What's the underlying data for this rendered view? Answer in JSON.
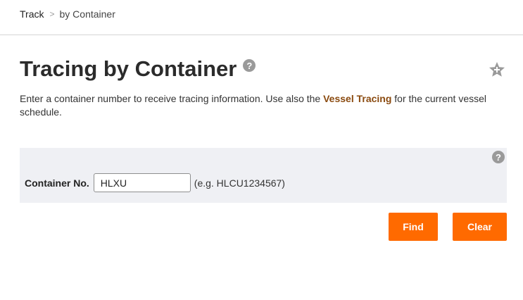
{
  "breadcrumb": {
    "root": "Track",
    "separator": ">",
    "current": "by Container"
  },
  "page": {
    "title": "Tracing by Container",
    "help_glyph": "?",
    "favorite_icon": "star-icon"
  },
  "intro": {
    "before_link": "Enter a container number to receive tracing information. Use also the ",
    "link": "Vessel Tracing",
    "after_link": " for the current vessel schedule."
  },
  "form": {
    "help_glyph": "?",
    "label": "Container No.",
    "input_value": "HLXU",
    "hint": "(e.g. HLCU1234567)"
  },
  "buttons": {
    "find": "Find",
    "clear": "Clear"
  },
  "colors": {
    "accent": "#ff6a00",
    "link": "#8a4a0f",
    "panel_bg": "#eff0f4",
    "icon_gray": "#9a9a9a"
  }
}
